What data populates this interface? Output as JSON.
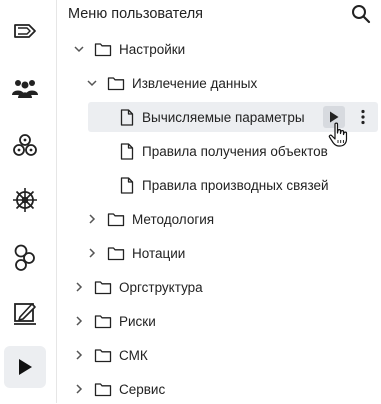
{
  "panel": {
    "title": "Меню пользователя"
  },
  "rail": {
    "items": [
      {
        "icon": "tag-icon"
      },
      {
        "icon": "users-icon"
      },
      {
        "icon": "molecule-icon"
      },
      {
        "icon": "helm-icon"
      },
      {
        "icon": "chain-icon"
      },
      {
        "icon": "pen-sign-icon"
      },
      {
        "icon": "play-icon",
        "active": true
      }
    ]
  },
  "tree": {
    "nastroiki": "Настройки",
    "izvlechenie": "Извлечение данных",
    "vychislyaemye": "Вычисляемые параметры",
    "pravila_polucheniya": "Правила получения объектов",
    "pravila_proizvodnyh": "Правила производных связей",
    "metodologiya": "Методология",
    "notacii": "Нотации",
    "orgstruktura": "Оргструктура",
    "riski": "Риски",
    "smk": "СМК",
    "servis": "Сервис"
  },
  "colors": {
    "selected_row": "#eceef1",
    "run_button": "#d7dadf",
    "icon": "#222222"
  }
}
